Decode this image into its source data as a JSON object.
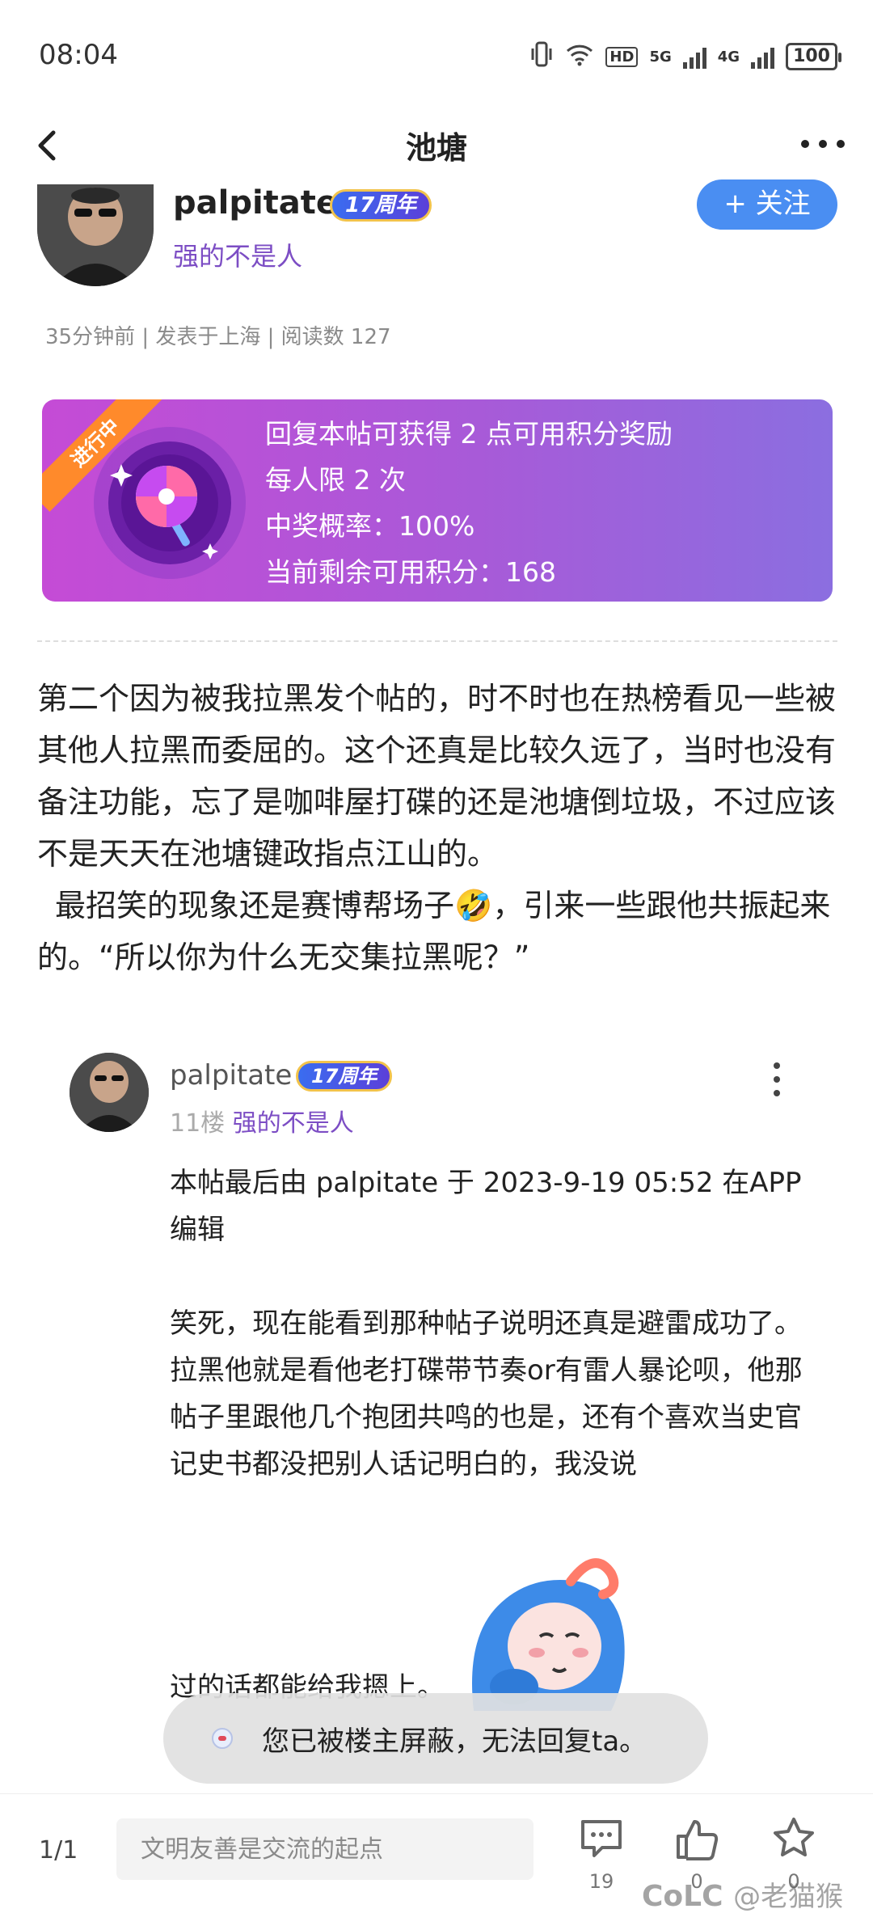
{
  "status_bar": {
    "time": "08:04",
    "hd": "HD",
    "net1": "5G",
    "net2": "4G",
    "battery": "100"
  },
  "nav": {
    "title": "池塘"
  },
  "author": {
    "name": "palpitate",
    "badge": "17周年",
    "title": "强的不是人",
    "follow": "+ 关注",
    "meta": "35分钟前 | 发表于上海 | 阅读数 127"
  },
  "reward": {
    "ribbon": "进行中",
    "lines": [
      "回复本帖可获得 2 点可用积分奖励",
      "每人限 2 次",
      "中奖概率：100%",
      "当前剩余可用积分：168"
    ]
  },
  "post": {
    "paragraphs": [
      "第二个因为被我拉黑发个帖的，时不时也在热榜看见一些被其他人拉黑而委屈的。这个还真是比较久远了，当时也没有备注功能，忘了是咖啡屋打碟的还是池塘倒垃圾，不过应该不是天天在池塘键政指点江山的。",
      "最招笑的现象还是赛博帮场子🤣，引来一些跟他共振起来的。“所以你为什么无交集拉黑呢？”"
    ]
  },
  "reply": {
    "name": "palpitate",
    "badge": "17周年",
    "floor": "11楼",
    "title": "强的不是人",
    "lines": [
      "本帖最后由 palpitate 于 2023-9-19 05:52 在APP 编辑",
      "",
      "笑死，现在能看到那种帖子说明还真是避雷成功了。",
      "拉黑他就是看他老打碟带节奏or有雷人暴论呗，他那帖子里跟他几个抱团共鸣的也是，还有个喜欢当史官记史书都没把别人话记明白的，我没说"
    ],
    "continued": "过的话都能给我摁上。"
  },
  "toast": {
    "text": "您已被楼主屏蔽，无法回复ta。"
  },
  "bottom_bar": {
    "page": "1/1",
    "input_placeholder": "文明友善是交流的起点",
    "comment_count": "19",
    "like_count": "0",
    "fav_count": "0",
    "watermark_logo": "CoLC",
    "watermark_text": "@老猫猴"
  }
}
